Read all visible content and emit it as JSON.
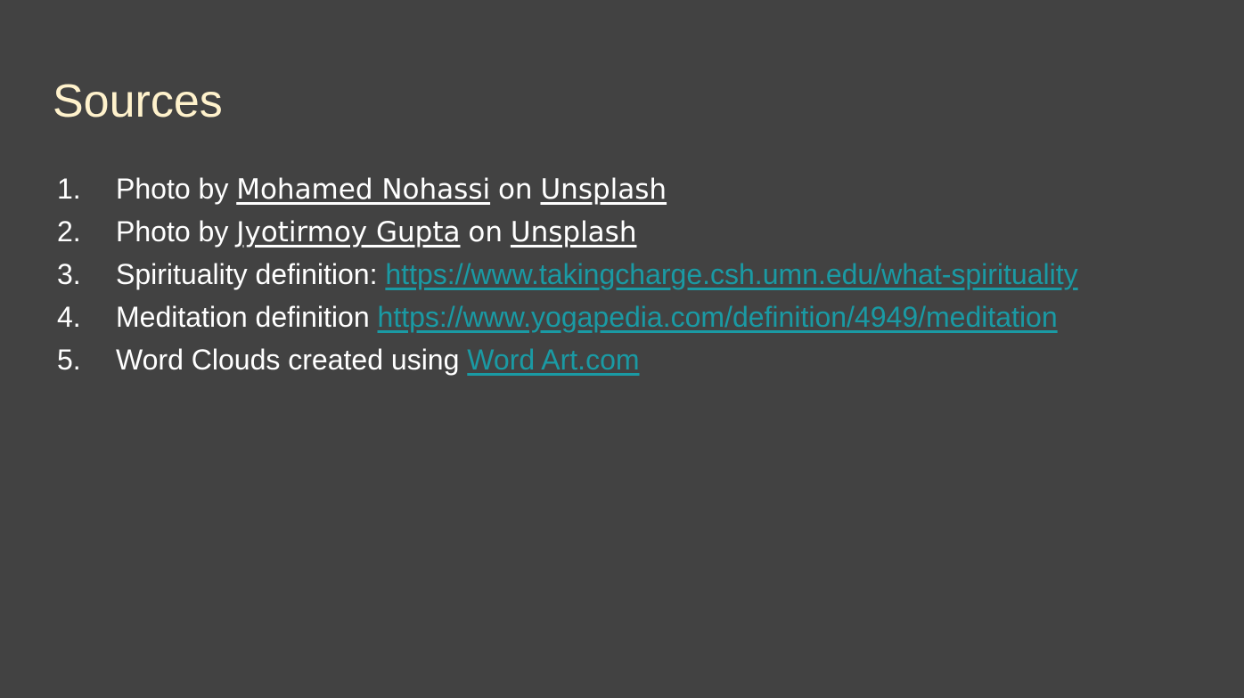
{
  "slide": {
    "title": "Sources",
    "colors": {
      "background": "#424242",
      "title": "#fff2cc",
      "text": "#ffffff",
      "link": "#1a9aa4"
    },
    "items": [
      {
        "number": "1.",
        "prefix": "Photo by ",
        "author": "Mohamed Nohassi",
        "middle": "on",
        "site": "Unsplash"
      },
      {
        "number": "2.",
        "prefix": "Photo by ",
        "author": "Jyotirmoy Gupta",
        "middle": "on",
        "site": "Unsplash"
      },
      {
        "number": "3.",
        "prefix": "Spirituality definition: ",
        "link": "https://www.takingcharge.csh.umn.edu/what-spirituality"
      },
      {
        "number": "4.",
        "prefix": "Meditation definition ",
        "link": "https://www.yogapedia.com/definition/4949/meditation"
      },
      {
        "number": "5.",
        "prefix": "Word Clouds created using ",
        "link": "Word Art.com"
      }
    ]
  }
}
